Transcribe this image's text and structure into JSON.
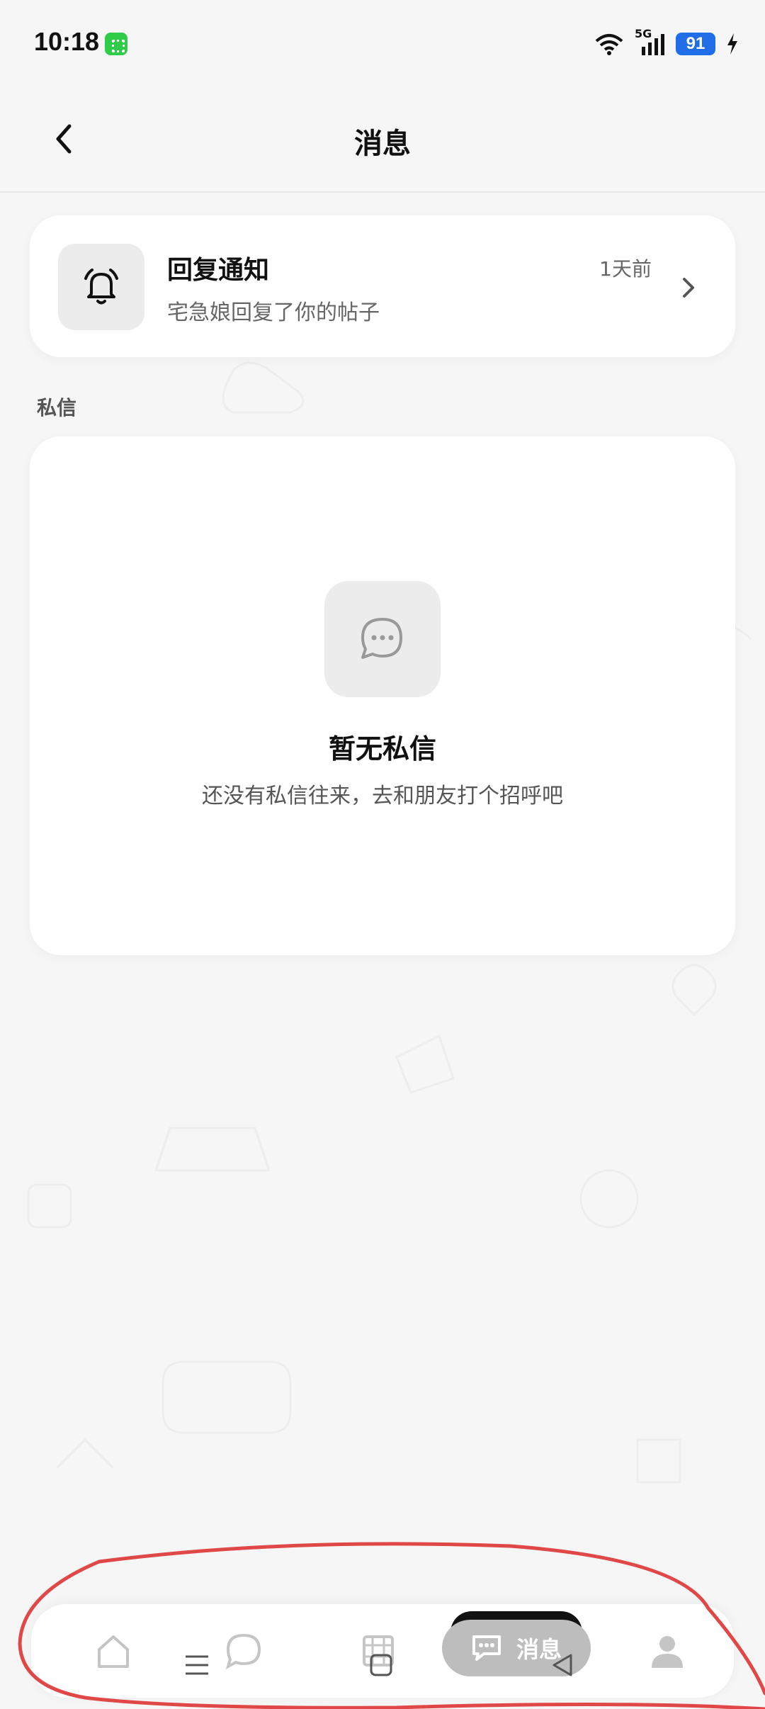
{
  "status_bar": {
    "time": "10:18",
    "network": "5G",
    "battery": "91",
    "battery_color": "#1f6ee8"
  },
  "header": {
    "title": "消息",
    "back_icon": "chevron-left-icon"
  },
  "notification": {
    "title": "回复通知",
    "subtitle": "宅急娘回复了你的帖子",
    "time": "1天前",
    "icon": "bell-icon"
  },
  "section": {
    "private_messages_label": "私信"
  },
  "empty_state": {
    "title": "暂无私信",
    "description": "还没有私信往来，去和朋友打个招呼吧",
    "icon": "chat-bubble-icon"
  },
  "bottom_nav": {
    "items": [
      {
        "icon": "home-icon"
      },
      {
        "icon": "chat-icon"
      },
      {
        "icon": "video-icon"
      },
      {
        "icon": "message-icon",
        "label": "消息",
        "active": true
      },
      {
        "icon": "profile-icon"
      }
    ]
  },
  "system_nav": {
    "buttons": [
      "menu-icon",
      "home-square-icon",
      "back-triangle-icon"
    ]
  },
  "colors": {
    "background": "#f6f6f6",
    "card": "#ffffff",
    "annotation": "#e04848"
  }
}
